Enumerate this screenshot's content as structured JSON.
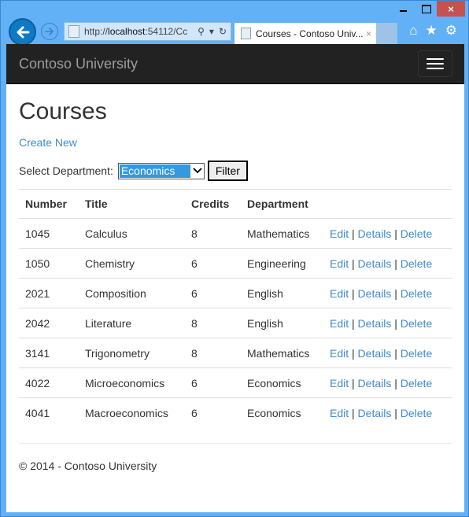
{
  "browser": {
    "window_controls": {
      "minimize": "",
      "maximize": "",
      "close": "×"
    },
    "address_bar": {
      "url_prefix": "http://",
      "url_host": "localhost",
      "url_rest": ":54112/Cc"
    },
    "address_icons": {
      "search": "⚲",
      "dropdown": "▾",
      "refresh": "↻"
    },
    "tab": {
      "title": "Courses - Contoso Univ...",
      "close": "×"
    },
    "toolbar_icons": {
      "home": "⌂",
      "favorites": "★",
      "settings": "⚙"
    }
  },
  "navbar": {
    "brand": "Contoso University"
  },
  "page": {
    "title": "Courses",
    "create_new": "Create New",
    "filter": {
      "label": "Select Department:",
      "selected": "Economics",
      "arrow": "⌄",
      "button": "Filter"
    },
    "table": {
      "headers": [
        "Number",
        "Title",
        "Credits",
        "Department",
        ""
      ],
      "rows": [
        {
          "number": "1045",
          "title": "Calculus",
          "credits": "8",
          "department": "Mathematics"
        },
        {
          "number": "1050",
          "title": "Chemistry",
          "credits": "6",
          "department": "Engineering"
        },
        {
          "number": "2021",
          "title": "Composition",
          "credits": "6",
          "department": "English"
        },
        {
          "number": "2042",
          "title": "Literature",
          "credits": "8",
          "department": "English"
        },
        {
          "number": "3141",
          "title": "Trigonometry",
          "credits": "8",
          "department": "Mathematics"
        },
        {
          "number": "4022",
          "title": "Microeconomics",
          "credits": "6",
          "department": "Economics"
        },
        {
          "number": "4041",
          "title": "Macroeconomics",
          "credits": "6",
          "department": "Economics"
        }
      ],
      "actions": {
        "edit": "Edit",
        "details": "Details",
        "delete": "Delete",
        "separator": "|"
      }
    },
    "footer": "© 2014 - Contoso University"
  }
}
